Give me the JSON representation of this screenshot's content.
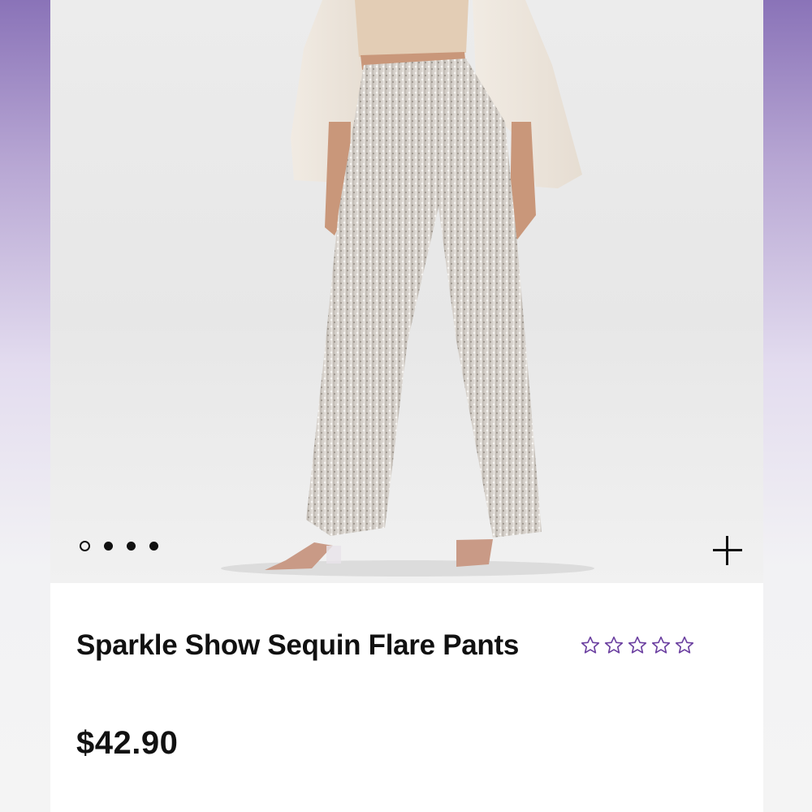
{
  "product": {
    "title": "Sparkle Show Sequin Flare Pants",
    "price": "$42.90",
    "rating": {
      "value": 0,
      "max": 5,
      "star_color": "#6b3fa0"
    }
  },
  "gallery": {
    "image_count": 4,
    "active_index": 0,
    "zoom_icon": "plus-icon"
  },
  "colors": {
    "frame_accent": "#8a73b8",
    "text": "#111111",
    "card": "#ffffff"
  }
}
